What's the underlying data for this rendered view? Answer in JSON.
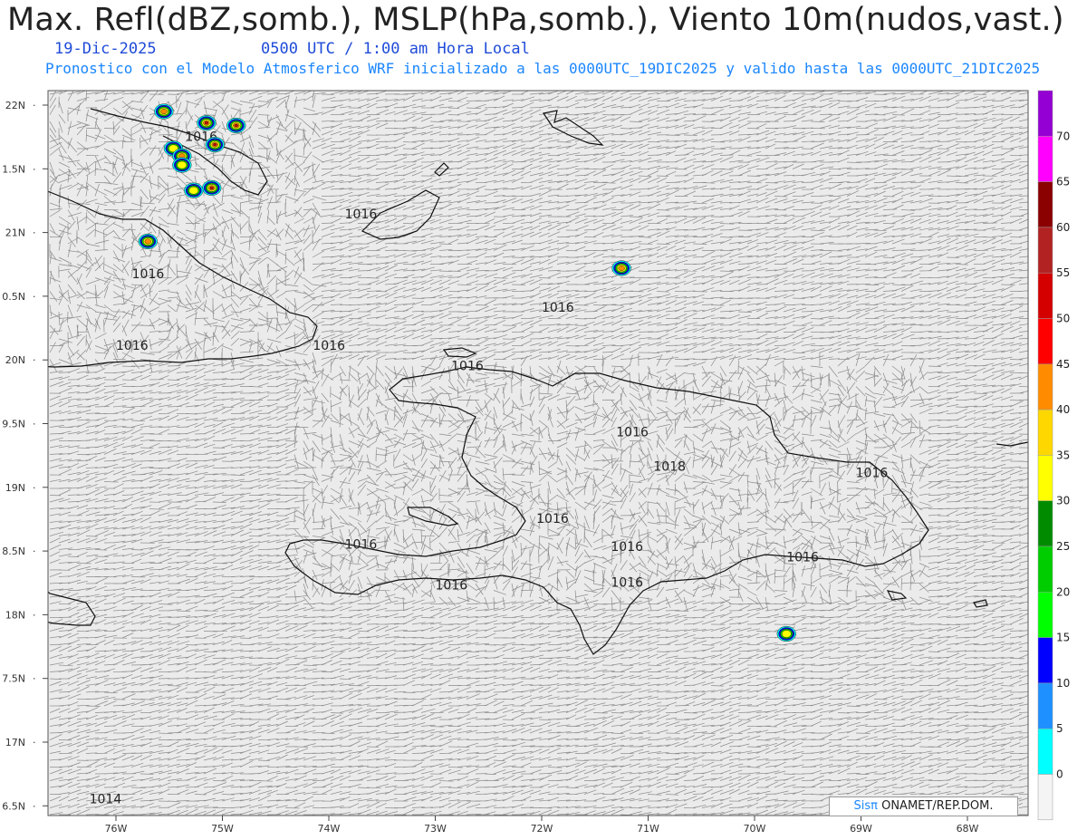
{
  "header": {
    "title": "Max. Refl(dBZ,somb.), MSLP(hPa,somb.), Viento 10m(nudos,vast.)",
    "date": "19-Dic-2025",
    "time": "0500 UTC / 1:00 am Hora Local",
    "subtitle": "Pronostico con el Modelo Atmosferico WRF inicializado a las 0000UTC_19DIC2025 y valido hasta las  0000UTC_21DIC2025"
  },
  "axes": {
    "lat_labels": [
      "22N",
      "1.5N",
      "21N",
      "0.5N",
      "20N",
      "9.5N",
      "19N",
      "8.5N",
      "18N",
      "7.5N",
      "17N",
      "6.5N"
    ],
    "lon_labels": [
      "76W",
      "75W",
      "74W",
      "73W",
      "72W",
      "71W",
      "70W",
      "69W",
      "68W"
    ]
  },
  "isobars": {
    "labels": [
      {
        "text": "1016",
        "lon": -75.35,
        "lat": 21.72
      },
      {
        "text": "1016",
        "lon": -73.85,
        "lat": 21.11
      },
      {
        "text": "1016",
        "lon": -75.85,
        "lat": 20.64
      },
      {
        "text": "1016",
        "lon": -76.0,
        "lat": 20.08
      },
      {
        "text": "1016",
        "lon": -74.15,
        "lat": 20.08
      },
      {
        "text": "1016",
        "lon": -72.0,
        "lat": 20.38
      },
      {
        "text": "1016",
        "lon": -72.85,
        "lat": 19.92
      },
      {
        "text": "1016",
        "lon": -71.3,
        "lat": 19.4
      },
      {
        "text": "1016",
        "lon": -69.05,
        "lat": 19.08
      },
      {
        "text": "1018",
        "lon": -70.95,
        "lat": 19.13
      },
      {
        "text": "1016",
        "lon": -72.05,
        "lat": 18.72
      },
      {
        "text": "1016",
        "lon": -73.85,
        "lat": 18.52
      },
      {
        "text": "1016",
        "lon": -71.35,
        "lat": 18.5
      },
      {
        "text": "1016",
        "lon": -69.7,
        "lat": 18.42
      },
      {
        "text": "1016",
        "lon": -71.35,
        "lat": 18.22
      },
      {
        "text": "1016",
        "lon": -73.0,
        "lat": 18.2
      },
      {
        "text": "1014",
        "lon": -76.25,
        "lat": 16.52
      }
    ]
  },
  "reflectivity_cells": [
    {
      "lon": -75.55,
      "lat": 21.95,
      "dbz": 45
    },
    {
      "lon": -75.15,
      "lat": 21.86,
      "dbz": 55
    },
    {
      "lon": -74.87,
      "lat": 21.84,
      "dbz": 55
    },
    {
      "lon": -75.07,
      "lat": 21.69,
      "dbz": 55
    },
    {
      "lon": -75.46,
      "lat": 21.66,
      "dbz": 40
    },
    {
      "lon": -75.38,
      "lat": 21.6,
      "dbz": 45
    },
    {
      "lon": -75.38,
      "lat": 21.53,
      "dbz": 40
    },
    {
      "lon": -75.1,
      "lat": 21.35,
      "dbz": 55
    },
    {
      "lon": -75.27,
      "lat": 21.33,
      "dbz": 40
    },
    {
      "lon": -75.7,
      "lat": 20.93,
      "dbz": 45
    },
    {
      "lon": -71.25,
      "lat": 20.72,
      "dbz": 45
    },
    {
      "lon": -69.7,
      "lat": 17.85,
      "dbz": 40
    }
  ],
  "colorbar": {
    "labels": [
      "70",
      "65",
      "60",
      "55",
      "50",
      "45",
      "40",
      "35",
      "30",
      "25",
      "20",
      "15",
      "10",
      "5",
      "0"
    ],
    "colors": [
      "#f4f4f4",
      "#00ffff",
      "#1e90ff",
      "#0000ff",
      "#00ff00",
      "#00cd00",
      "#008b00",
      "#ffff00",
      "#ffd700",
      "#ff8c00",
      "#ff0000",
      "#d40000",
      "#b22222",
      "#8b0000",
      "#ff00ff",
      "#9400d3"
    ]
  },
  "credit": {
    "sis": "Sisπ",
    "rest": " ONAMET/REP.DOM."
  }
}
